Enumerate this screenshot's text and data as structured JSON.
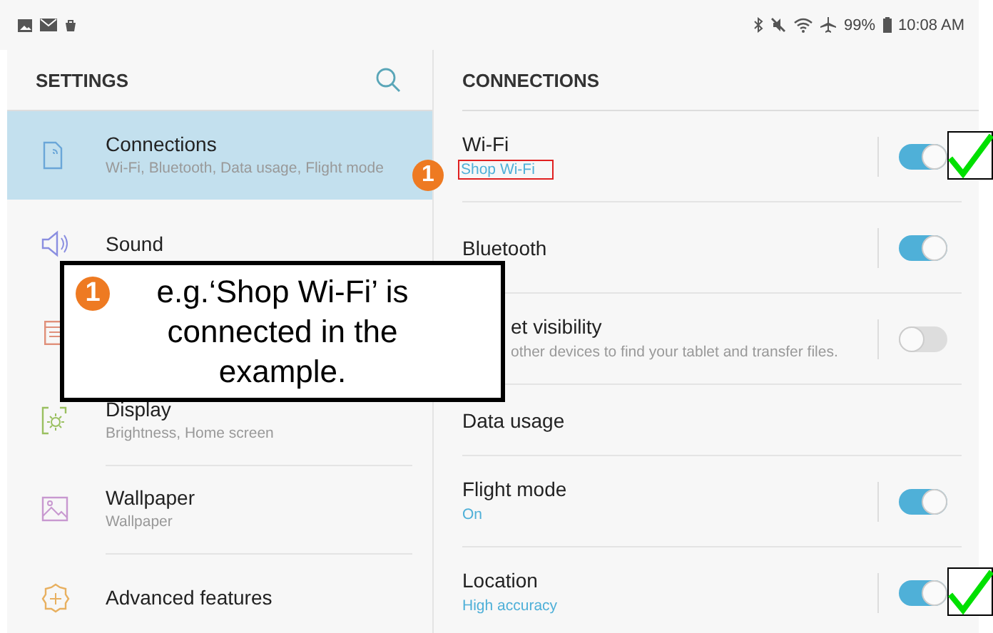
{
  "status_bar": {
    "battery": "99%",
    "time": "10:08 AM"
  },
  "sidebar": {
    "title": "SETTINGS",
    "items": [
      {
        "title": "Connections",
        "subtitle": "Wi-Fi, Bluetooth, Data usage, Flight mode",
        "selected": true
      },
      {
        "title": "Sound",
        "selected": false
      },
      {
        "selected": false
      },
      {
        "title": "Display",
        "subtitle": "Brightness, Home screen",
        "selected": false
      },
      {
        "title": "Wallpaper",
        "subtitle": "Wallpaper",
        "selected": false
      },
      {
        "title": "Advanced features",
        "selected": false
      }
    ]
  },
  "content": {
    "title": "CONNECTIONS",
    "items": [
      {
        "kind": "toggle",
        "title": "Wi-Fi",
        "subtitle": "Shop Wi-Fi",
        "on": true,
        "highlighted": true,
        "badge": "1",
        "checked": true
      },
      {
        "kind": "toggle",
        "title": "Bluetooth",
        "on": true,
        "checked": false
      },
      {
        "kind": "toggle",
        "title": "et visibility",
        "subtitle": "other devices to find your tablet and transfer files.",
        "on": false,
        "checked": false
      },
      {
        "kind": "plain",
        "title": "Data usage"
      },
      {
        "kind": "toggle",
        "title": "Flight mode",
        "subtitle": "On",
        "on": true,
        "checked": false
      },
      {
        "kind": "toggle",
        "title": "Location",
        "subtitle": "High accuracy",
        "on": true,
        "checked": true
      }
    ]
  },
  "callout": {
    "badge": "1",
    "text": "e.g.‘Shop Wi-Fi’ is connected in the example."
  }
}
